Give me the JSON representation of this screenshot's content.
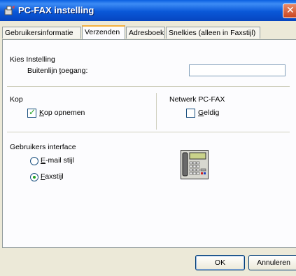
{
  "window": {
    "title": "PC-FAX instelling",
    "close_glyph": "✕"
  },
  "tabs": [
    {
      "label": "Gebruikersinformatie",
      "active": false
    },
    {
      "label": "Verzenden",
      "active": true
    },
    {
      "label": "Adresboek",
      "active": false
    },
    {
      "label": "Snelkies (alleen in Faxstijl)",
      "active": false
    }
  ],
  "kies_instelling": {
    "heading": "Kies Instelling",
    "buitenlijn": {
      "label_pre": "Buitenlijn ",
      "label_accel": "t",
      "label_post": "oegang:",
      "value": ""
    }
  },
  "kop": {
    "heading": "Kop",
    "checkbox_accel": "K",
    "checkbox_rest": "op opnemen",
    "checked": true
  },
  "netwerk": {
    "heading": "Netwerk PC-FAX",
    "checkbox_accel": "G",
    "checkbox_rest": "eldig",
    "checked": false
  },
  "gebruikers_interface": {
    "heading": "Gebruikers interface",
    "options": [
      {
        "accel": "E",
        "rest": "-mail stijl",
        "selected": false
      },
      {
        "accel": "F",
        "rest": "axstijl",
        "selected": true
      }
    ],
    "icon": "fax-machine-icon"
  },
  "buttons": {
    "ok": "OK",
    "cancel": "Annuleren"
  },
  "colors": {
    "titlebar": "#0a58d8",
    "face": "#ece9d8",
    "check": "#21a121"
  }
}
